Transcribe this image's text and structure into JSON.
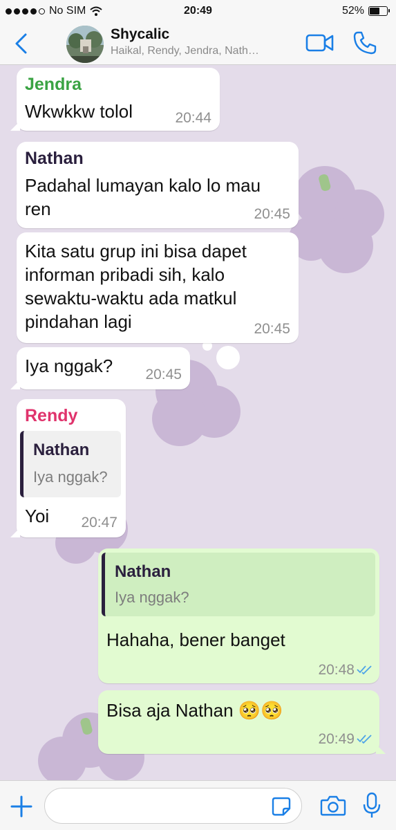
{
  "status_bar": {
    "carrier": "No SIM",
    "time": "20:49",
    "battery_percent": "52%",
    "signal_bars_filled": 4
  },
  "header": {
    "title": "Shycalic",
    "subtitle": "Haikal, Rendy, Jendra, Nath…",
    "icons": [
      "back-chevron-icon",
      "video-call-icon",
      "phone-call-icon"
    ],
    "accent_color": "#1a7fe6"
  },
  "messages": [
    {
      "sender": "Jendra",
      "sender_color": "#3aa343",
      "text": "Wkwkkw tolol",
      "time": "20:44"
    },
    {
      "sender": "Nathan",
      "sender_color": "#2a1f3d",
      "text_lines": [
        "Padahal lumayan kalo lo mau",
        "ren"
      ],
      "time": "20:45"
    },
    {
      "text_lines": [
        "Kita satu grup ini bisa dapet",
        "informan pribadi sih, kalo",
        "sewaktu-waktu ada matkul",
        "pindahan lagi"
      ],
      "time": "20:45"
    },
    {
      "text": "Iya nggak?",
      "time": "20:45"
    },
    {
      "sender": "Rendy",
      "sender_color": "#e0336c",
      "quote": {
        "name": "Nathan",
        "text": "Iya nggak?"
      },
      "text": "Yoi",
      "time": "20:47"
    },
    {
      "outgoing": true,
      "quote": {
        "name": "Nathan",
        "text": "Iya nggak?"
      },
      "text": "Hahaha, bener banget",
      "time": "20:48",
      "status": "read"
    },
    {
      "outgoing": true,
      "text": "Bisa aja Nathan 🥺🥺",
      "time": "20:49",
      "status": "read"
    }
  ],
  "input_bar": {
    "placeholder": "",
    "icons": [
      "plus-icon",
      "sticker-icon",
      "camera-icon",
      "microphone-icon"
    ]
  }
}
